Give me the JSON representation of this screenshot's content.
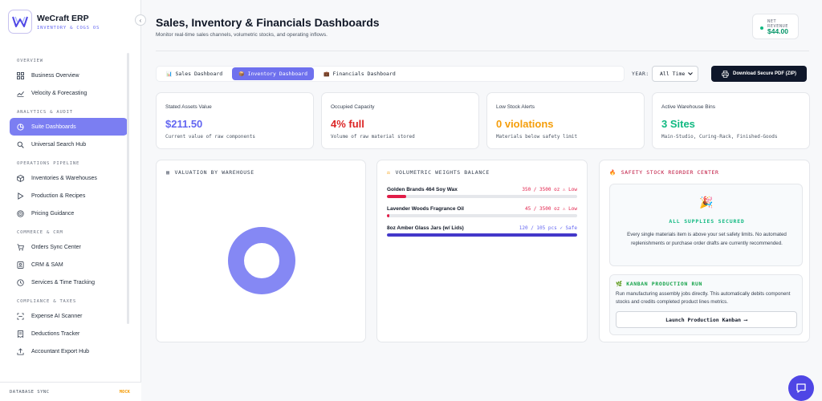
{
  "brand": {
    "name": "WeCraft ERP",
    "subtitle": "INVENTORY & COGS OS"
  },
  "sidebar": {
    "collapse_icon": "‹",
    "sections": [
      {
        "title": "OVERVIEW",
        "items": [
          {
            "label": "Business Overview",
            "icon": "grid-icon"
          },
          {
            "label": "Velocity & Forecasting",
            "icon": "trend-icon"
          }
        ]
      },
      {
        "title": "ANALYTICS & AUDIT",
        "items": [
          {
            "label": "Suite Dashboards",
            "icon": "pie-icon",
            "active": true
          },
          {
            "label": "Universal Search Hub",
            "icon": "search-icon"
          }
        ]
      },
      {
        "title": "OPERATIONS PIPELINE",
        "items": [
          {
            "label": "Inventories & Warehouses",
            "icon": "box-icon"
          },
          {
            "label": "Production & Recipes",
            "icon": "play-icon"
          },
          {
            "label": "Pricing Guidance",
            "icon": "target-icon"
          }
        ]
      },
      {
        "title": "COMMERCE & CRM",
        "items": [
          {
            "label": "Orders Sync Center",
            "icon": "cart-icon"
          },
          {
            "label": "CRM & SAM",
            "icon": "contacts-icon"
          },
          {
            "label": "Services & Time Tracking",
            "icon": "clock-icon"
          }
        ]
      },
      {
        "title": "COMPLIANCE & TAXES",
        "items": [
          {
            "label": "Expense AI Scanner",
            "icon": "scanner-icon"
          },
          {
            "label": "Deductions Tracker",
            "icon": "receipt-icon"
          },
          {
            "label": "Accountant Export Hub",
            "icon": "export-icon"
          }
        ]
      }
    ],
    "db_sync": {
      "label": "DATABASE SYNC",
      "status": "MOCK"
    }
  },
  "header": {
    "title": "Sales, Inventory & Financials Dashboards",
    "subtitle": "Monitor real-time sales channels, volumetric stocks, and operating inflows.",
    "revenue": {
      "label": "NET REVENUE",
      "value": "$44.00"
    }
  },
  "tabs": [
    {
      "label": "Sales Dashboard",
      "icon": "📊",
      "active": false
    },
    {
      "label": "Inventory Dashboard",
      "icon": "📦",
      "active": true
    },
    {
      "label": "Financials Dashboard",
      "icon": "💼",
      "active": false
    }
  ],
  "year": {
    "label": "YEAR:",
    "value": "All Time"
  },
  "download": {
    "label": "Download Secure PDF (ZIP)"
  },
  "kpis": [
    {
      "label": "Stated Assets Value",
      "value": "$211.50",
      "sub": "Current value of raw components",
      "color": "#6366f1"
    },
    {
      "label": "Occupied Capacity",
      "value": "4% full",
      "sub": "Volume of raw material stored",
      "color": "#dc2626"
    },
    {
      "label": "Low Stock Alerts",
      "value": "0 violations",
      "sub": "Materials below safety limit",
      "color": "#f59e0b"
    },
    {
      "label": "Active Warehouse Bins",
      "value": "3 Sites",
      "sub": "Main-Studio, Curing-Rack, Finished-Goods",
      "color": "#10b981"
    }
  ],
  "valuation": {
    "title": "VALUATION BY WAREHOUSE",
    "icon": "▦",
    "slices": [
      {
        "value": 1,
        "color": "#8588f4"
      }
    ]
  },
  "volumetric": {
    "title": "VOLUMETRIC WEIGHTS BALANCE",
    "icon": "⚖",
    "rows": [
      {
        "name": "Golden Brands 464 Soy Wax",
        "status": "350 / 3500 oz ⚠ Low",
        "fraction": 0.1,
        "color": "#e11d48",
        "status_color": "#e11d48"
      },
      {
        "name": "Lavender Woods Fragrance Oil",
        "status": "45 / 3500 oz ⚠ Low",
        "fraction": 0.013,
        "color": "#e11d48",
        "status_color": "#e11d48"
      },
      {
        "name": "8oz Amber Glass Jars (w/ Lids)",
        "status": "120 / 105 pcs ✓ Safe",
        "fraction": 1,
        "color": "#4338ca",
        "status_color": "#6366f1"
      }
    ]
  },
  "reorder": {
    "title": "SAFETY STOCK REORDER CENTER",
    "icon": "🔥",
    "secured_icon": "🎉",
    "secured_title": "ALL SUPPLIES SECURED",
    "secured_text": "Every single materials item is above your set safety limits. No automated replenishments or purchase order drafts are currently recommended.",
    "kanban_icon": "🌿",
    "kanban_title": "KANBAN PRODUCTION RUN",
    "kanban_text": "Run manufacturing assembly jobs directly. This automatically debits component stocks and credits completed product lines metrics.",
    "kanban_button": "Launch Production Kanban ⟶"
  }
}
